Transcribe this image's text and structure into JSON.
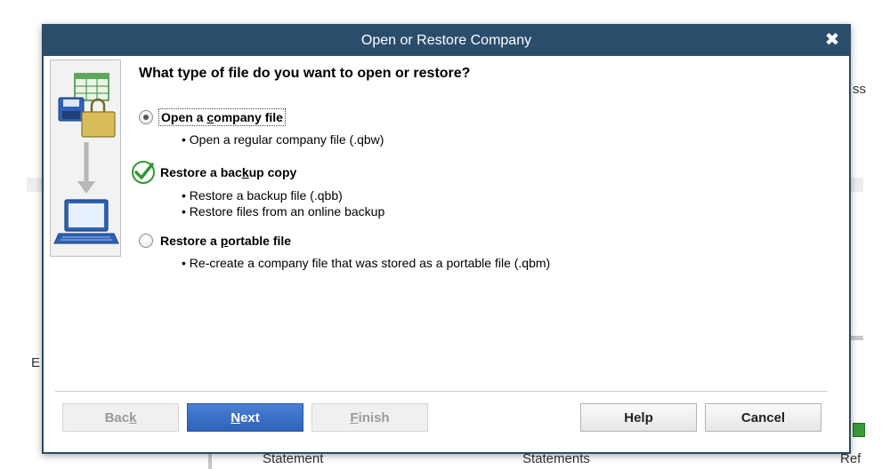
{
  "background": {
    "label_ess": "ss",
    "label_e": "E",
    "statement_1": "Statement",
    "statement_2": "Statements",
    "ref": "Ref"
  },
  "dialog": {
    "title": "Open or Restore Company",
    "question": "What type of file do you want to open or restore?",
    "options": [
      {
        "label_pre": "Open a ",
        "label_ul": "c",
        "label_post": "ompany file",
        "selected": true,
        "bullets": [
          "• Open a regular company file (.qbw)"
        ]
      },
      {
        "label_pre": "Restore a bac",
        "label_ul": "k",
        "label_post": "up copy",
        "selected": false,
        "bullets": [
          "• Restore a backup file (.qbb)",
          "• Restore files from an online backup"
        ]
      },
      {
        "label_pre": "Restore a ",
        "label_ul": "p",
        "label_post": "ortable file",
        "selected": false,
        "bullets": [
          "• Re-create a company file that was stored as a portable file (.qbm)"
        ]
      }
    ],
    "buttons": {
      "back_pre": "Bac",
      "back_ul": "k",
      "next_ul": "N",
      "next_post": "ext",
      "finish_ul": "F",
      "finish_post": "inish",
      "help": "Help",
      "cancel": "Cancel"
    }
  }
}
